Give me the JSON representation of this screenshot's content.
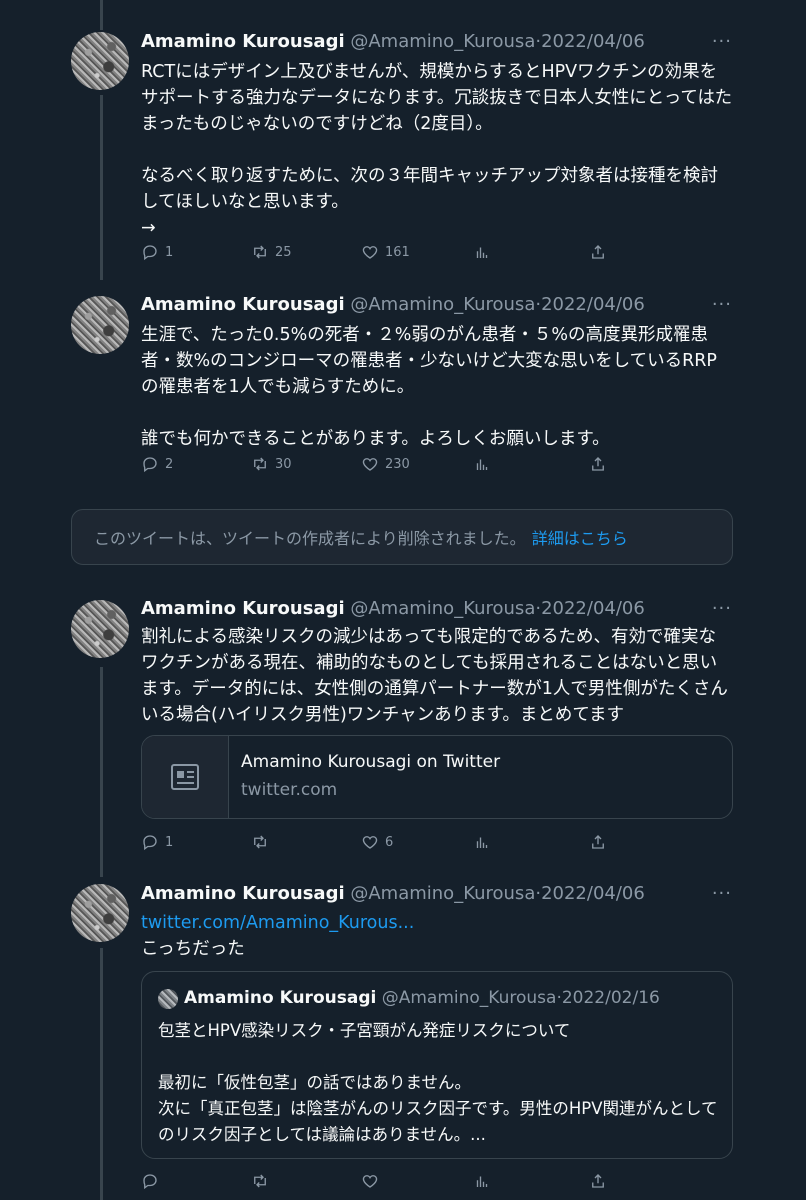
{
  "tweets": [
    {
      "name": "Amamino Kurousagi",
      "handle": "@Amamino_Kurousa",
      "dot": "·",
      "date": "2022/04/06",
      "more": "···",
      "paragraphs": [
        "RCTにはデザイン上及びませんが、規模からするとHPVワクチンの効果をサポートする強力なデータになります。冗談抜きで日本人女性にとってはたまったものじゃないのですけどね（2度目）。",
        "なるべく取り返すために、次の３年間キャッチアップ対象者は接種を検討してほしいなと思います。",
        "→"
      ],
      "replies": "1",
      "retweets": "25",
      "likes": "161"
    },
    {
      "name": "Amamino Kurousagi",
      "handle": "@Amamino_Kurousa",
      "dot": "·",
      "date": "2022/04/06",
      "more": "···",
      "paragraphs": [
        "生涯で、たった0.5%の死者・２%弱のがん患者・５%の高度異形成罹患者・数%のコンジローマの罹患者・少ないけど大変な思いをしているRRPの罹患者を1人でも減らすために。",
        "誰でも何かできることがあります。よろしくお願いします。"
      ],
      "replies": "2",
      "retweets": "30",
      "likes": "230"
    },
    {
      "name": "Amamino Kurousagi",
      "handle": "@Amamino_Kurousa",
      "dot": "·",
      "date": "2022/04/06",
      "more": "···",
      "paragraphs": [
        "割礼による感染リスクの減少はあっても限定的であるため、有効で確実なワクチンがある現在、補助的なものとしても採用されることはないと思います。データ的には、女性側の通算パートナー数が1人で男性側がたくさんいる場合(ハイリスク男性)ワンチャンあります。まとめてます"
      ],
      "replies": "1",
      "retweets": "",
      "likes": "6"
    },
    {
      "name": "Amamino Kurousagi",
      "handle": "@Amamino_Kurousa",
      "dot": "·",
      "date": "2022/04/06",
      "more": "···",
      "link": "twitter.com/Amamino_Kurous...",
      "paragraphs": [
        "こっちだった"
      ],
      "replies": "",
      "retweets": "",
      "likes": ""
    }
  ],
  "deleted_notice": {
    "text": "このツイートは、ツイートの作成者により削除されました。",
    "link": "詳細はこちら"
  },
  "card": {
    "title": "Amamino Kurousagi on Twitter",
    "domain": "twitter.com",
    "icon": "article-icon"
  },
  "quote": {
    "name": "Amamino Kurousagi",
    "handle": "@Amamino_Kurousa",
    "dot": "·",
    "date": "2022/02/16",
    "paragraphs": [
      "包茎とHPV感染リスク・子宮頸がん発症リスクについて",
      "最初に「仮性包茎」の話ではありません。\n次に「真正包茎」は陰茎がんのリスク因子です。男性のHPV関連がんとしてのリスク因子としては議論はありません。..."
    ]
  },
  "colors": {
    "background": "#15202b",
    "accent": "#1d9bf0",
    "muted": "#8b98a5",
    "border": "#38444d"
  }
}
